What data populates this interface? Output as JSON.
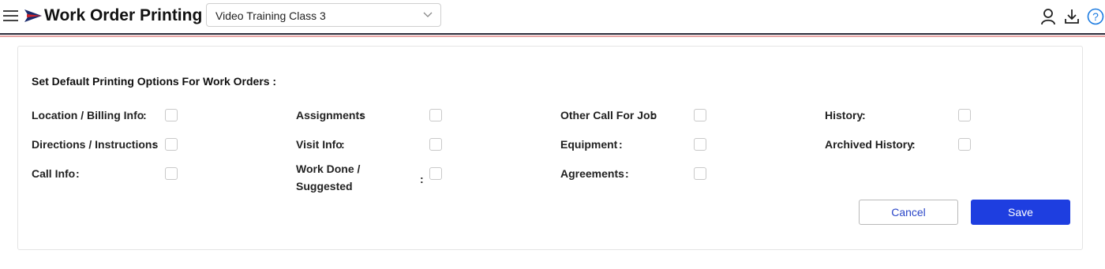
{
  "header": {
    "title": "Work Order Printing",
    "company_select": {
      "value": "Video Training Class 3"
    },
    "icons": [
      "menu-icon",
      "logo-icon",
      "user-icon",
      "download-icon",
      "help-icon"
    ]
  },
  "form": {
    "section_title": "Set Default Printing Options For Work Orders :",
    "options": [
      {
        "label": "Location / Billing Info",
        "colon": ":",
        "checked": false
      },
      {
        "label": "Assignments",
        "colon": ":",
        "checked": false
      },
      {
        "label": "Other Call For Job",
        "colon": ":",
        "checked": false
      },
      {
        "label": "History",
        "colon": ":",
        "checked": false
      },
      {
        "label": "Directions / Instructions",
        "colon": ":",
        "checked": false
      },
      {
        "label": "Visit Info",
        "colon": ":",
        "checked": false
      },
      {
        "label": "Equipment",
        "colon": ":",
        "checked": false
      },
      {
        "label": "Archived History",
        "colon": ":",
        "checked": false
      },
      {
        "label": "Call Info",
        "colon": ":",
        "checked": false
      },
      {
        "label": "Work Done / Suggested",
        "colon": ":",
        "checked": false
      },
      {
        "label": "Agreements",
        "colon": ":",
        "checked": false
      }
    ],
    "cancel_label": "Cancel",
    "save_label": "Save"
  },
  "colors": {
    "primary": "#1e3ee0",
    "help": "#1a7ae0",
    "stripe_dark": "#2b2b3a",
    "stripe_light": "#e6a3a3"
  }
}
